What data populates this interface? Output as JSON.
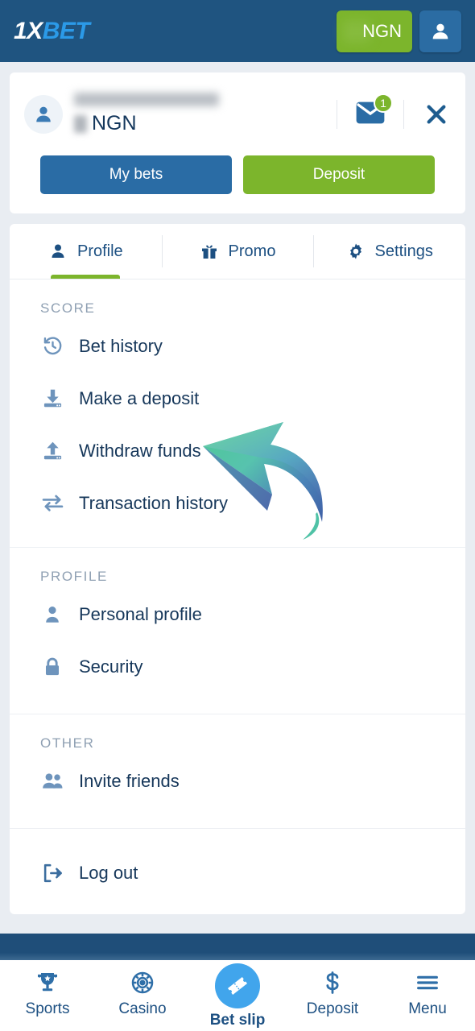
{
  "header": {
    "logo_part1": "1X",
    "logo_part2": "BET",
    "balance_currency": "NGN",
    "balance_amount_hidden": "",
    "account_icon": "user-icon"
  },
  "user_card": {
    "username_hidden": "",
    "balance_currency": "NGN",
    "mail_icon": "envelope-icon",
    "mail_badge_count": "1",
    "close_icon": "close-icon",
    "my_bets_label": "My bets",
    "deposit_label": "Deposit"
  },
  "tabs": [
    {
      "label": "Profile",
      "icon": "user-icon",
      "active": true
    },
    {
      "label": "Promo",
      "icon": "gift-icon",
      "active": false
    },
    {
      "label": "Settings",
      "icon": "gear-icon",
      "active": false
    }
  ],
  "sections": [
    {
      "title": "SCORE",
      "items": [
        {
          "label": "Bet history",
          "icon": "history-clock-icon"
        },
        {
          "label": "Make a deposit",
          "icon": "download-icon"
        },
        {
          "label": "Withdraw funds",
          "icon": "upload-icon"
        },
        {
          "label": "Transaction history",
          "icon": "exchange-arrows-icon"
        }
      ]
    },
    {
      "title": "PROFILE",
      "items": [
        {
          "label": "Personal profile",
          "icon": "person-icon"
        },
        {
          "label": "Security",
          "icon": "lock-icon"
        }
      ]
    },
    {
      "title": "OTHER",
      "items": [
        {
          "label": "Invite friends",
          "icon": "people-icon"
        }
      ]
    }
  ],
  "logout": {
    "label": "Log out",
    "icon": "logout-icon"
  },
  "annotation": {
    "type": "curved-arrow",
    "points_to": "Withdraw funds",
    "gradient_from": "#3fc08a",
    "gradient_to": "#3f62a8"
  },
  "bottom_nav": [
    {
      "label": "Sports",
      "icon": "trophy-icon",
      "active": false
    },
    {
      "label": "Casino",
      "icon": "casino-chip-icon",
      "active": false
    },
    {
      "label": "Bet slip",
      "icon": "bet-ticket-icon",
      "active": true
    },
    {
      "label": "Deposit",
      "icon": "dollar-icon",
      "active": false
    },
    {
      "label": "Menu",
      "icon": "hamburger-icon",
      "active": false
    }
  ],
  "colors": {
    "header_navy": "#1f5480",
    "accent_green": "#7cb52c",
    "accent_blue": "#2a6ca5",
    "bet_slip_blue": "#41a5ec",
    "page_bg": "#e9edf2",
    "text_dark": "#16375a",
    "muted": "#8fa0b3"
  }
}
